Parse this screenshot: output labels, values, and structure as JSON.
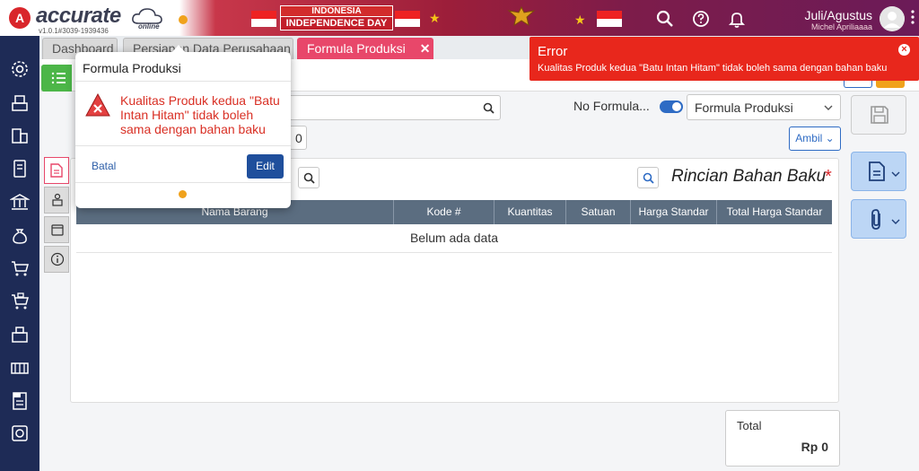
{
  "app": {
    "logo_letter": "A",
    "logo_text": "accurate",
    "logo_sub": "online",
    "version": "v1.0.1#3039-1939436"
  },
  "banner": {
    "line1": "INDONESIA",
    "line2": "INDEPENDENCE DAY"
  },
  "user": {
    "period": "Juli/Agustus",
    "name": "Michel Apriliaaaa"
  },
  "tabs": [
    {
      "label": "Dashboard"
    },
    {
      "label": "Persiapan Data Perusahaan"
    },
    {
      "label": "Formula Produksi",
      "close": "✕"
    }
  ],
  "form": {
    "no_formula_label": "No Formula...",
    "formula_select": "Formula Produksi",
    "qty_value": "0",
    "ambil_label": "Ambil"
  },
  "panel": {
    "title": "Rincian Bahan Baku",
    "required_mark": "*",
    "columns": [
      "Nama Barang",
      "Kode #",
      "Kuantitas",
      "Satuan",
      "Harga Standar",
      "Total Harga Standar"
    ],
    "empty_text": "Belum ada data"
  },
  "total": {
    "label": "Total",
    "value": "Rp 0"
  },
  "popover": {
    "title": "Formula Produksi",
    "message": "Kualitas Produk kedua \"Batu Intan Hitam\" tidak boleh sama dengan bahan baku",
    "cancel_label": "Batal",
    "edit_label": "Edit"
  },
  "toast": {
    "title": "Error",
    "message": "Kualitas Produk kedua \"Batu Intan Hitam\" tidak boleh sama dengan bahan baku",
    "close": "×"
  },
  "colors": {
    "sidebar": "#1e2b56",
    "accent_tab": "#e8476a",
    "error": "#e8271c",
    "primary": "#1f4f9c",
    "green": "#4cb648"
  }
}
